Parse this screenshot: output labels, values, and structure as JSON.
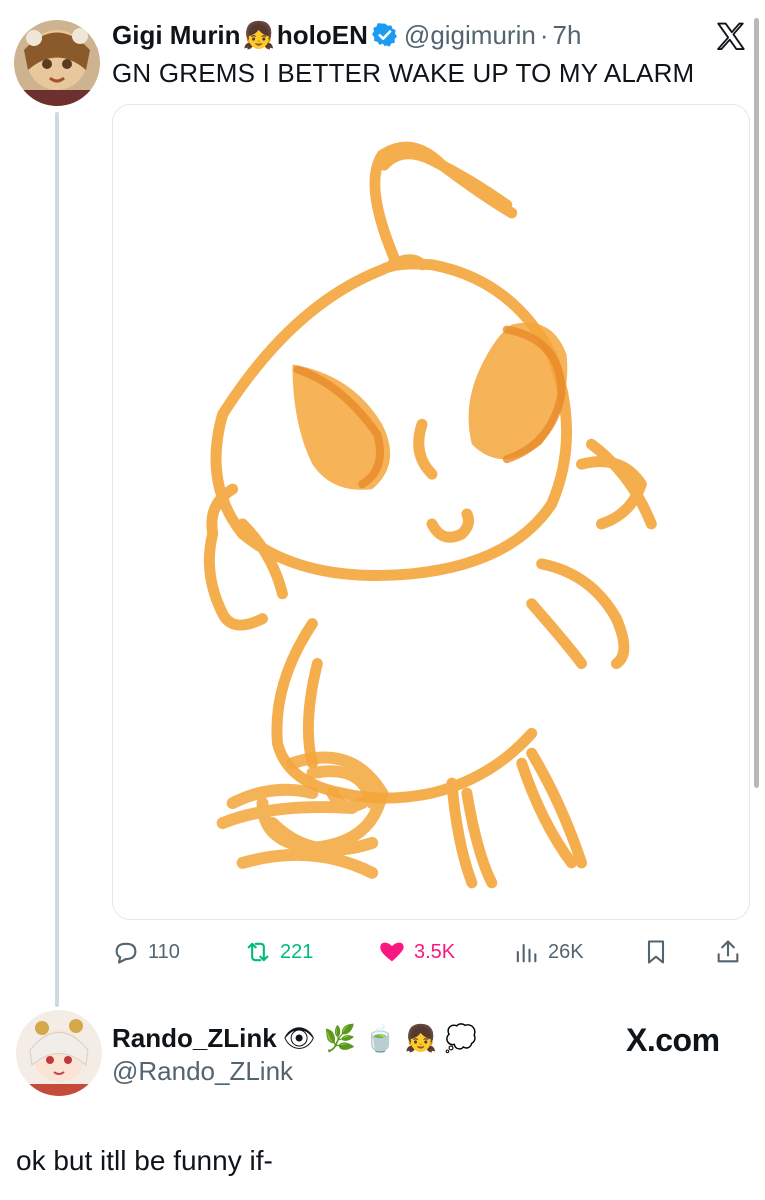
{
  "tweet": {
    "display_name": "Gigi Murin",
    "affiliation": "holoEN",
    "name_emoji": "👧",
    "handle": "@gigimurin",
    "time": "7h",
    "separator": "·",
    "text": "GN GREMS I BETTER WAKE UP TO MY ALARM",
    "media_icon": "orange-creature-doodle",
    "stats": {
      "replies": "110",
      "retweets": "221",
      "likes": "3.5K",
      "views": "26K"
    }
  },
  "reply": {
    "display_name": "Rando_ZLink",
    "name_emojis": [
      "👁",
      "🌿",
      "🍵",
      "👧",
      "💭"
    ],
    "handle": "@Rando_ZLink",
    "text": "ok but itll be funny if-"
  },
  "branding": {
    "site": "X.com"
  },
  "colors": {
    "text": "#0f1419",
    "secondary": "#536471",
    "retweet": "#00ba7c",
    "like": "#f91880",
    "verified": "#1d9bf0",
    "doodle": "#f4a63b"
  }
}
